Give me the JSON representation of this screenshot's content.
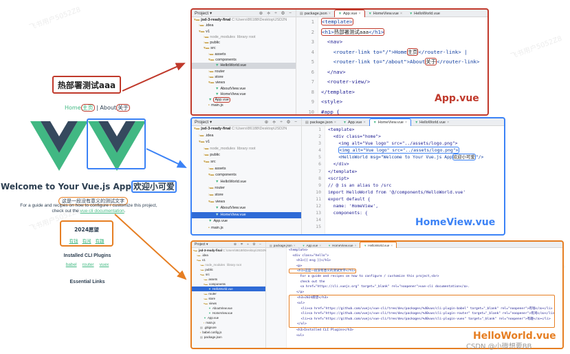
{
  "preview": {
    "hot_title": "热部署测试aaa",
    "nav": {
      "home": "Home",
      "home_suffix": "主页",
      "sep": " | ",
      "about": "About",
      "about_suffix": "关于"
    },
    "welcome": "Welcome to Your Vue.js App",
    "welcome_suffix": "欢迎小可爱",
    "meaningless": "这是一段没有意义的测试文字",
    "guide_line1": "For a guide and recipes on how to configure / customize this project,",
    "guide_line2_prefix": "check out the ",
    "guide_link": "vue-cli documentation",
    "guide_line2_suffix": ".",
    "wish_title": "2024愿望",
    "wish_items": [
      "有钱",
      "有闲",
      "有趣"
    ],
    "plugins_title": "Installed CLI Plugins",
    "plugins": [
      "babel",
      "router",
      "vuex"
    ],
    "essential_title": "Essential Links"
  },
  "ide": {
    "project_label": "Project",
    "project_name": "jsd-3-ready-final",
    "project_path": "C:\\Users\\86188\\Desktop\\JSD2N",
    "tool_icons": "⊕ ≑ ÷ ⚙ −",
    "node_modules_hint": "library root",
    "tabs": [
      "package.json",
      "App.vue",
      "HomeView.vue",
      "HelloWorld.vue"
    ]
  },
  "panel_app": {
    "tree": [
      {
        "name": "jsd-3-ready-final",
        "kind": "root"
      },
      {
        "name": ".idea",
        "kind": "folder"
      },
      {
        "name": "v1",
        "kind": "folder"
      },
      {
        "name": "node_modules",
        "kind": "folder"
      },
      {
        "name": "public",
        "kind": "folder"
      },
      {
        "name": "src",
        "kind": "folder"
      },
      {
        "name": "assets",
        "kind": "folder"
      },
      {
        "name": "components",
        "kind": "folder"
      },
      {
        "name": "HelloWorld.vue",
        "kind": "vue"
      },
      {
        "name": "router",
        "kind": "folder"
      },
      {
        "name": "store",
        "kind": "folder"
      },
      {
        "name": "views",
        "kind": "folder"
      },
      {
        "name": "AboutView.vue",
        "kind": "vue"
      },
      {
        "name": "HomeView.vue",
        "kind": "vue"
      },
      {
        "name": "App.vue",
        "kind": "vue"
      },
      {
        "name": "main.js",
        "kind": "js"
      }
    ],
    "line_numbers": [
      "1",
      "2",
      "3",
      "4",
      "5",
      "6",
      "7",
      "8",
      "9",
      "10",
      "11"
    ],
    "code": {
      "l1": "<template>",
      "l2a": "<h1>",
      "l2b": "热部署测试aaa",
      "l2c": "</h1>",
      "l3": "  <nav>",
      "l4a": "    <router-link to=\"/\">Home",
      "l4b": "主页",
      "l4c": "</router-link> |",
      "l5a": "    <router-link to=\"/about\">About",
      "l5b": "关于",
      "l5c": "</router-link>",
      "l6": "  </nav>",
      "l7": "  <router-view/>",
      "l8": "</template>",
      "l9": "",
      "l10": "<style>",
      "l11": "#app {"
    },
    "label": "App.vue"
  },
  "panel_home": {
    "tree": [
      {
        "name": "jsd-3-ready-final",
        "kind": "root"
      },
      {
        "name": ".idea",
        "kind": "folder"
      },
      {
        "name": "v1",
        "kind": "folder"
      },
      {
        "name": "node_modules",
        "kind": "folder"
      },
      {
        "name": "public",
        "kind": "folder"
      },
      {
        "name": "src",
        "kind": "folder"
      },
      {
        "name": "assets",
        "kind": "folder"
      },
      {
        "name": "components",
        "kind": "folder"
      },
      {
        "name": "HelloWorld.vue",
        "kind": "vue"
      },
      {
        "name": "router",
        "kind": "folder"
      },
      {
        "name": "store",
        "kind": "folder"
      },
      {
        "name": "views",
        "kind": "folder"
      },
      {
        "name": "AboutView.vue",
        "kind": "vue"
      },
      {
        "name": "HomeView.vue",
        "kind": "vue"
      },
      {
        "name": "App.vue",
        "kind": "vue"
      },
      {
        "name": "main.js",
        "kind": "js"
      }
    ],
    "line_numbers": [
      "1",
      "2",
      "3",
      "4",
      "5",
      "6",
      "7",
      "8",
      "9",
      "10",
      "11",
      "12",
      "13",
      "14",
      "15",
      "16"
    ],
    "code": {
      "l1": "<template>",
      "l2": "  <div class=\"home\">",
      "l3": "    <img alt=\"Vue logo\" src=\"../assets/logo.png\">",
      "l4": "<img alt=\"Vue logo\" src=\"../assets/logo.png\">",
      "l5a": "    <HelloWorld msg=\"Welcome to Your Vue.js App",
      "l5b": "欢迎小可爱",
      "l5c": "\"/>",
      "l6": "  </div>",
      "l7": "</template>",
      "l8": "",
      "l9": "<script>",
      "l10": "// @ is an alias to /src",
      "l11": "import HelloWorld from '@/components/HelloWorld.vue'",
      "l12": "",
      "l13": "export default {",
      "l14": "  name: 'HomeView',",
      "l15": "  components: {"
    },
    "label": "HomeView.vue"
  },
  "panel_hello": {
    "tree": [
      {
        "name": "jsd-3-ready-final",
        "kind": "root"
      },
      {
        "name": ".idea",
        "kind": "folder"
      },
      {
        "name": "v1",
        "kind": "folder"
      },
      {
        "name": "node_modules",
        "kind": "folder"
      },
      {
        "name": "public",
        "kind": "folder"
      },
      {
        "name": "src",
        "kind": "folder"
      },
      {
        "name": "assets",
        "kind": "folder"
      },
      {
        "name": "components",
        "kind": "folder"
      },
      {
        "name": "HelloWorld.vue",
        "kind": "vue"
      },
      {
        "name": "router",
        "kind": "folder"
      },
      {
        "name": "store",
        "kind": "folder"
      },
      {
        "name": "views",
        "kind": "folder"
      },
      {
        "name": "AboutView.vue",
        "kind": "vue"
      },
      {
        "name": "HomeView.vue",
        "kind": "vue"
      },
      {
        "name": "App.vue",
        "kind": "vue"
      },
      {
        "name": "main.js",
        "kind": "js"
      },
      {
        "name": ".gitignore",
        "kind": "file"
      },
      {
        "name": "babel.config.js",
        "kind": "js"
      },
      {
        "name": "package.json",
        "kind": "file"
      }
    ],
    "code": [
      "<template>",
      "  <div class=\"hello\">",
      "    <h1>{{ msg }}</h1>",
      "    <p>",
      "    <h1>这是一段没有意义的测试文字</h1>",
      "      For a guide and recipes on how to configure / customize this project,<br>",
      "      check out the",
      "      <a href=\"https://cli.vuejs.org\" target=\"_blank\" rel=\"noopener\">vue-cli documentation</a>.",
      "    </p>",
      "    <h3>2024愿望</h3>",
      "    <ul>",
      "      <li><a href=\"https://github.com/vuejs/vue-cli/tree/dev/packages/%40vue/cli-plugin-babel\" target=\"_blank\" rel=\"noopener\">有钱</a></li>",
      "      <li><a href=\"https://github.com/vuejs/vue-cli/tree/dev/packages/%40vue/cli-plugin-router\" target=\"_blank\" rel=\"noopener\">有闲</a></li>",
      "      <li><a href=\"https://github.com/vuejs/vue-cli/tree/dev/packages/%40vue/cli-plugin-vuex\" target=\"_blank\" rel=\"noopener\">有趣</a></li>",
      "    </ul>",
      "    <h3>Installed CLI Plugins</h3>",
      "    <ul>"
    ],
    "label": "HelloWorld.vue"
  },
  "watermark": "CSDN @小微想要BB",
  "bg_watermark": "飞书用户5052Z8",
  "colors": {
    "red": "#c0392b",
    "blue": "#3b82f6",
    "orange": "#e67e22",
    "vue_green": "#41b883",
    "vue_dark": "#35495e"
  }
}
